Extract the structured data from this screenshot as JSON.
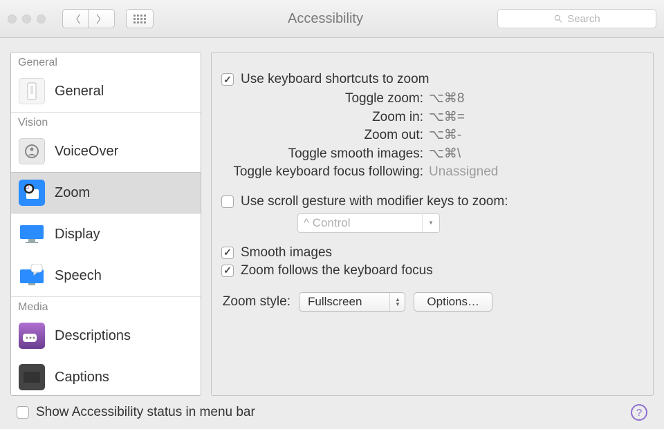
{
  "window": {
    "title": "Accessibility",
    "search_placeholder": "Search"
  },
  "sidebar": {
    "sections": {
      "general": "General",
      "vision": "Vision",
      "media": "Media"
    },
    "items": {
      "general": "General",
      "voiceover": "VoiceOver",
      "zoom": "Zoom",
      "display": "Display",
      "speech": "Speech",
      "descriptions": "Descriptions",
      "captions": "Captions"
    },
    "selected": "zoom"
  },
  "zoom": {
    "use_shortcuts": {
      "label": "Use keyboard shortcuts to zoom",
      "checked": true
    },
    "shortcuts": {
      "toggle_zoom": {
        "label": "Toggle zoom:",
        "value": "⌥⌘8"
      },
      "zoom_in": {
        "label": "Zoom in:",
        "value": "⌥⌘="
      },
      "zoom_out": {
        "label": "Zoom out:",
        "value": "⌥⌘-"
      },
      "toggle_smooth": {
        "label": "Toggle smooth images:",
        "value": "⌥⌘\\"
      },
      "toggle_focus": {
        "label": "Toggle keyboard focus following:",
        "value": "Unassigned"
      }
    },
    "scroll_gesture": {
      "label": "Use scroll gesture with modifier keys to zoom:",
      "checked": false,
      "modifier": "^ Control"
    },
    "smooth_images": {
      "label": "Smooth images",
      "checked": true
    },
    "follow_focus": {
      "label": "Zoom follows the keyboard focus",
      "checked": true
    },
    "style": {
      "label": "Zoom style:",
      "value": "Fullscreen",
      "options_label": "Options…"
    }
  },
  "footer": {
    "status_label": "Show Accessibility status in menu bar",
    "status_checked": false
  }
}
